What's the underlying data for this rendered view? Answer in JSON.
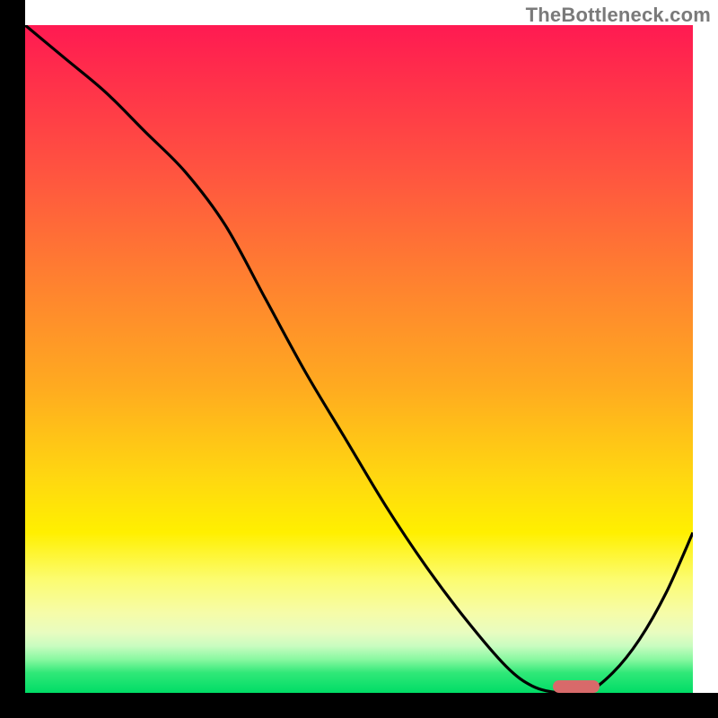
{
  "watermark": "TheBottleneck.com",
  "chart_data": {
    "type": "line",
    "title": "",
    "xlabel": "",
    "ylabel": "",
    "xlim": [
      0,
      100
    ],
    "ylim": [
      0,
      100
    ],
    "grid": false,
    "background": "red-to-green vertical gradient (high=red, low=green)",
    "series": [
      {
        "name": "bottleneck-curve",
        "x": [
          0,
          6,
          12,
          18,
          24,
          30,
          36,
          42,
          48,
          54,
          60,
          66,
          72,
          76,
          80,
          84,
          88,
          92,
          96,
          100
        ],
        "y": [
          100,
          95,
          90,
          84,
          78,
          70,
          59,
          48,
          38,
          28,
          19,
          11,
          4,
          1,
          0,
          0,
          3,
          8,
          15,
          24
        ]
      }
    ],
    "marker": {
      "name": "optimal-range",
      "x_start": 79,
      "x_end": 86,
      "y": 0,
      "color": "#d86a6a"
    }
  },
  "colors": {
    "axis": "#000000",
    "curve": "#000000",
    "marker": "#d86a6a",
    "watermark": "#7a7a7a"
  }
}
